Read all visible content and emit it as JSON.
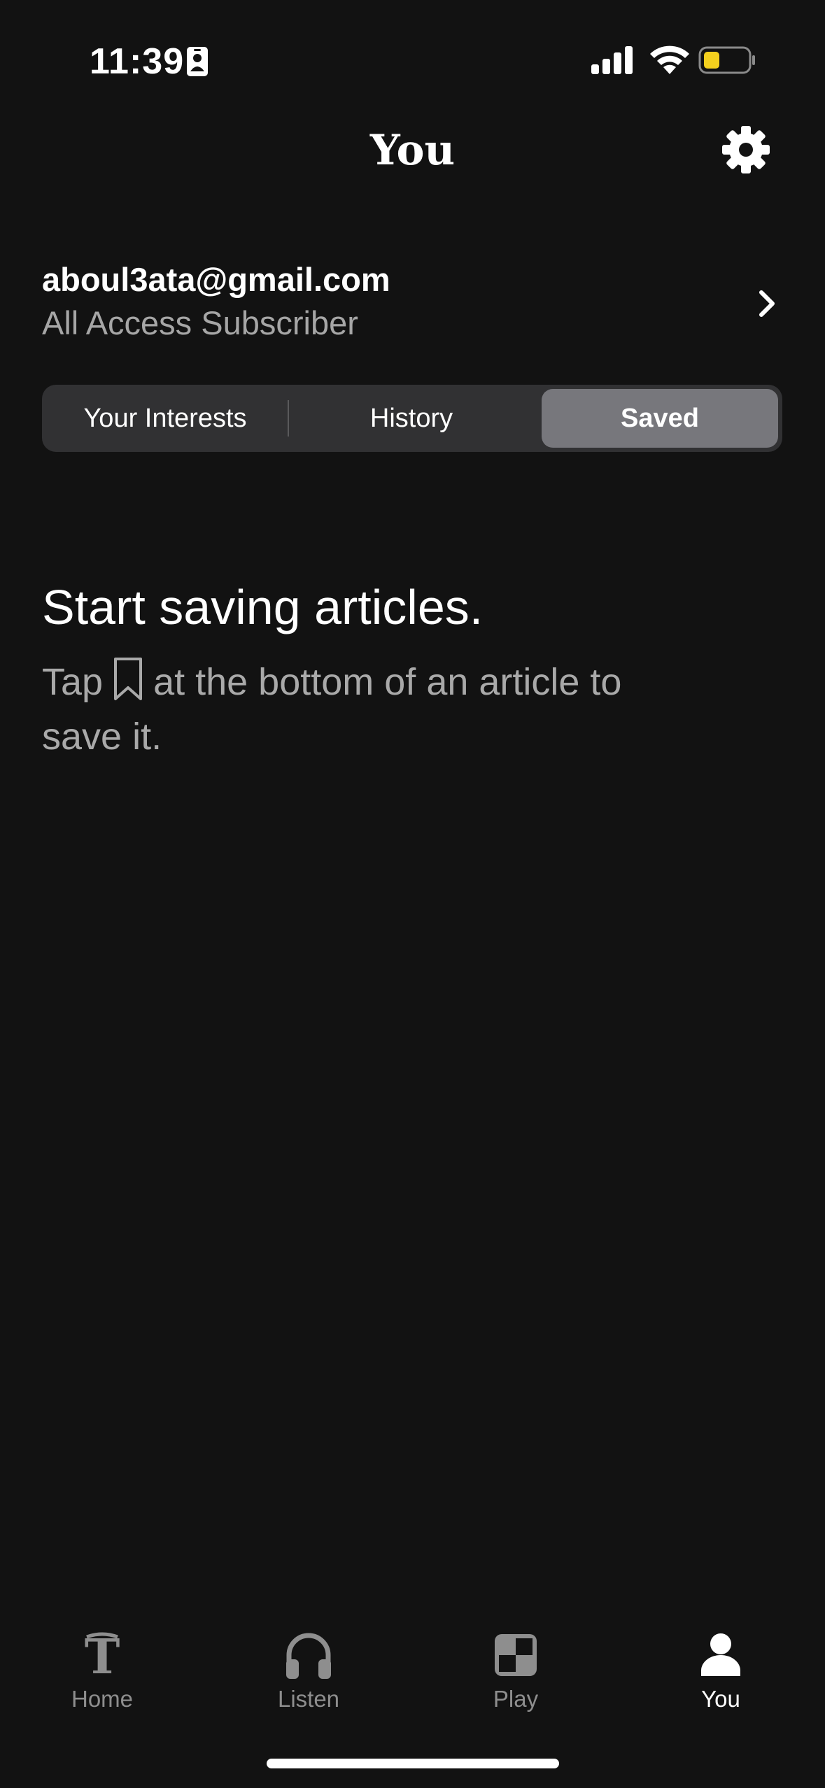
{
  "status_bar": {
    "time": "11:39",
    "icons": [
      "id-card-icon",
      "cellular-signal-icon",
      "wifi-icon",
      "battery-low-icon"
    ],
    "battery_color": "#f4d01e"
  },
  "header": {
    "title": "You",
    "settings_icon": "gear-icon"
  },
  "account": {
    "email": "aboul3ata@gmail.com",
    "plan": "All Access Subscriber",
    "chevron_icon": "chevron-right-icon"
  },
  "segments": {
    "items": [
      {
        "label": "Your Interests",
        "selected": false
      },
      {
        "label": "History",
        "selected": false
      },
      {
        "label": "Saved",
        "selected": true
      }
    ]
  },
  "empty_state": {
    "title": "Start saving articles.",
    "body_prefix": "Tap",
    "body_icon": "bookmark-icon",
    "body_suffix": "at the bottom of an article to",
    "body_line2": "save it."
  },
  "tab_bar": {
    "items": [
      {
        "label": "Home",
        "icon": "nyt-logo-icon",
        "active": false
      },
      {
        "label": "Listen",
        "icon": "headphones-icon",
        "active": false
      },
      {
        "label": "Play",
        "icon": "games-grid-icon",
        "active": false
      },
      {
        "label": "You",
        "icon": "person-icon",
        "active": true
      }
    ]
  },
  "colors": {
    "background": "#121212",
    "segment_bg": "#313133",
    "segment_selected": "#77777c",
    "secondary_text": "#a6a6a6",
    "inactive_tab": "#8e8e8e"
  }
}
